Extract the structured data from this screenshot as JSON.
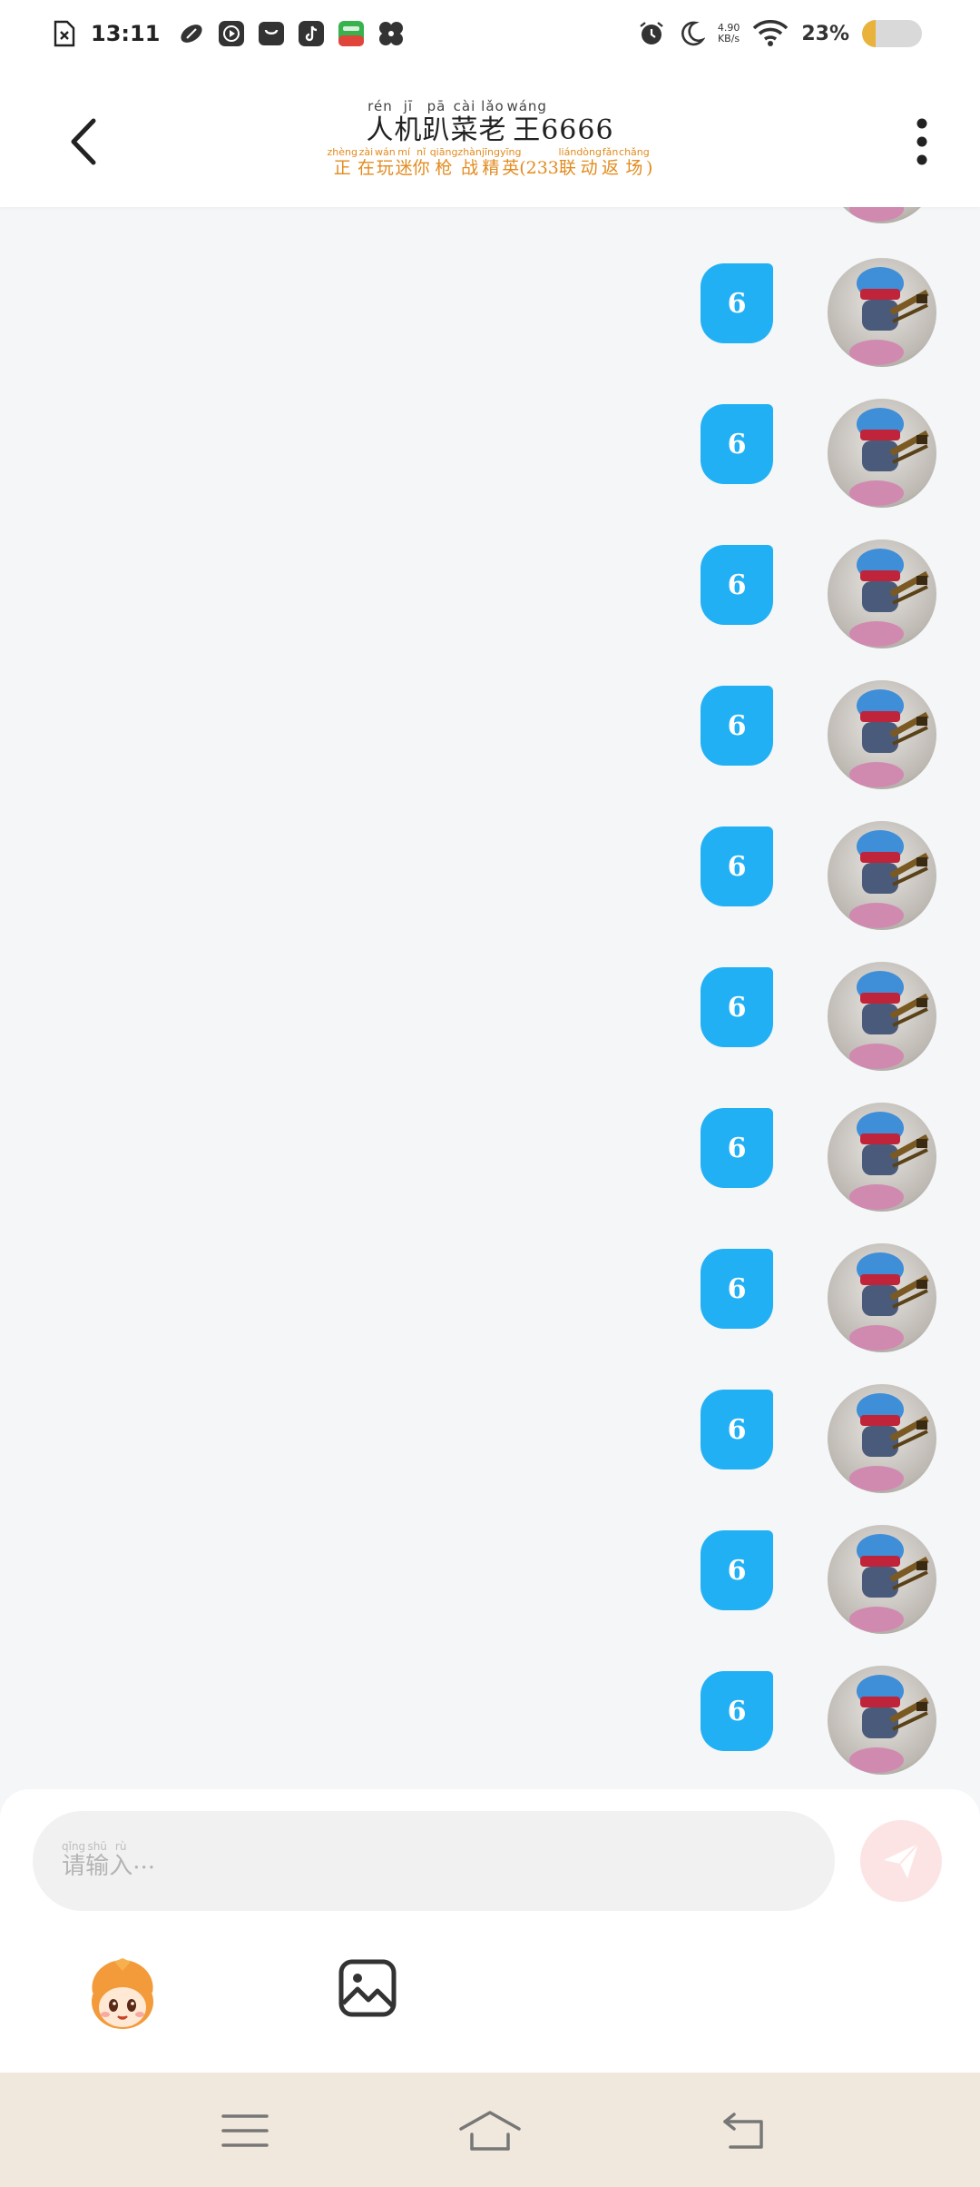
{
  "status_bar": {
    "time": "13:11",
    "net_speed_value": "4.90",
    "net_speed_unit": "KB/s",
    "battery_percent": "23%",
    "battery_level": 0.23,
    "icons": [
      "file-x-icon",
      "rugby-ball-icon",
      "play-icon",
      "bag-icon",
      "tiktok-icon",
      "app-store-icon",
      "fan-icon",
      "alarm-icon",
      "moon-icon",
      "wifi-icon",
      "battery-icon"
    ]
  },
  "header": {
    "title_chars": [
      {
        "c": "人",
        "p": "rén"
      },
      {
        "c": "机",
        "p": "jī"
      },
      {
        "c": "趴",
        "p": "pā"
      },
      {
        "c": "菜",
        "p": "cài"
      },
      {
        "c": "老",
        "p": "lǎo"
      },
      {
        "c": "王",
        "p": "wáng"
      }
    ],
    "title_suffix": "6666",
    "subtitle_chars": [
      {
        "c": "正",
        "p": "zhèng"
      },
      {
        "c": "在",
        "p": "zài"
      },
      {
        "c": "玩",
        "p": "wán"
      },
      {
        "c": "迷",
        "p": "mí"
      },
      {
        "c": "你",
        "p": "nǐ"
      },
      {
        "c": "枪",
        "p": "qiāng"
      },
      {
        "c": "战",
        "p": "zhàn"
      },
      {
        "c": "精",
        "p": "jīng"
      },
      {
        "c": "英",
        "p": "yīng"
      }
    ],
    "subtitle_mid": "(233",
    "subtitle_chars2": [
      {
        "c": "联",
        "p": "lián"
      },
      {
        "c": "动",
        "p": "dòng"
      },
      {
        "c": "返",
        "p": "fǎn"
      },
      {
        "c": "场",
        "p": "chǎng"
      }
    ],
    "subtitle_end": ")"
  },
  "messages": [
    {
      "text": "6"
    },
    {
      "text": "6"
    },
    {
      "text": "6"
    },
    {
      "text": "6"
    },
    {
      "text": "6"
    },
    {
      "text": "6"
    },
    {
      "text": "6"
    },
    {
      "text": "6"
    },
    {
      "text": "6"
    },
    {
      "text": "6"
    },
    {
      "text": "6"
    }
  ],
  "composer": {
    "placeholder_chars": [
      {
        "c": "请",
        "p": "qǐng"
      },
      {
        "c": "输",
        "p": "shū"
      },
      {
        "c": "入",
        "p": "rù"
      }
    ],
    "placeholder_tail": " ..."
  },
  "colors": {
    "bubble": "#22b0f5",
    "subtitle": "#e28b1e",
    "nav_bg": "#f0e8dc",
    "send_btn": "#fde4e4"
  }
}
